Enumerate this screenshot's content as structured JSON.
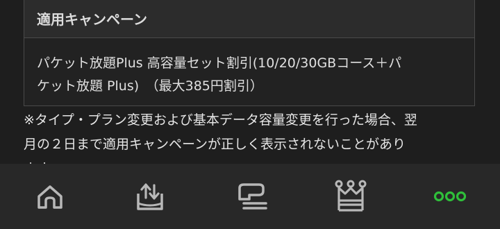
{
  "campaign": {
    "header": "適用キャンペーン",
    "lines": [
      "パケット放題Plus 高容量セット割引(10/20/30GBコース＋パ",
      "ケット放題 Plus)　（最大385円割引）"
    ]
  },
  "note": {
    "lines": [
      "※タイプ・プラン変更および基本データ容量変更を行った場合、翌",
      "月の２日まで適用キャンペーンが正しく表示されないことがあり",
      "ます。"
    ]
  },
  "tabbar": {
    "tabs": [
      {
        "icon": "home-icon"
      },
      {
        "icon": "upload-tray-icon"
      },
      {
        "icon": "plan-list-icon"
      },
      {
        "icon": "crown-icon"
      },
      {
        "icon": "more-dots-icon",
        "active": true
      }
    ],
    "active_color": "#2fbf3a",
    "icon_color": "#b8b8b8"
  }
}
